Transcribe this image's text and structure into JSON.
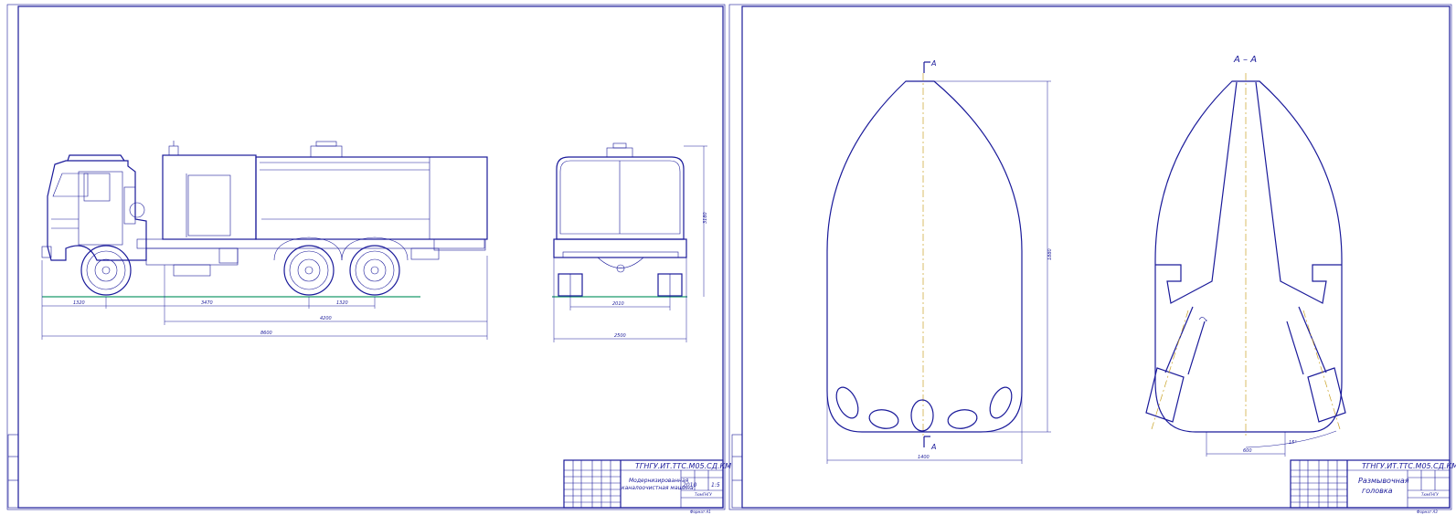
{
  "sheet1": {
    "title_block": {
      "doc_code": "ТГНГУ.ИТ.ТТС.М05.СД.КМ",
      "name_line1": "Модернизированная",
      "name_line2": "каналоочистная машина",
      "mass": "2010",
      "scale": "1:5",
      "org": "ТюмГНГУ",
      "format": "Формат А1"
    },
    "dimensions": {
      "front_overhang": "1320",
      "wheelbase": "3470",
      "bogie": "1320",
      "body_length": "4200",
      "overall_length": "8600",
      "height": "3180",
      "track": "2010",
      "width": "2500"
    }
  },
  "sheet2": {
    "section_label": "А – А",
    "cut_mark_top": "А",
    "cut_mark_bottom": "А",
    "title_block": {
      "doc_code": "ТГНГУ.ИТ.ТТС.М05.СД.КМ",
      "name_line1": "Размывочная",
      "name_line2": "головка",
      "org": "ТюмГНГУ",
      "format": "Формат А3"
    },
    "dimensions": {
      "width": "1400",
      "height": "1880",
      "inner_width": "600",
      "angle": "15°"
    }
  }
}
